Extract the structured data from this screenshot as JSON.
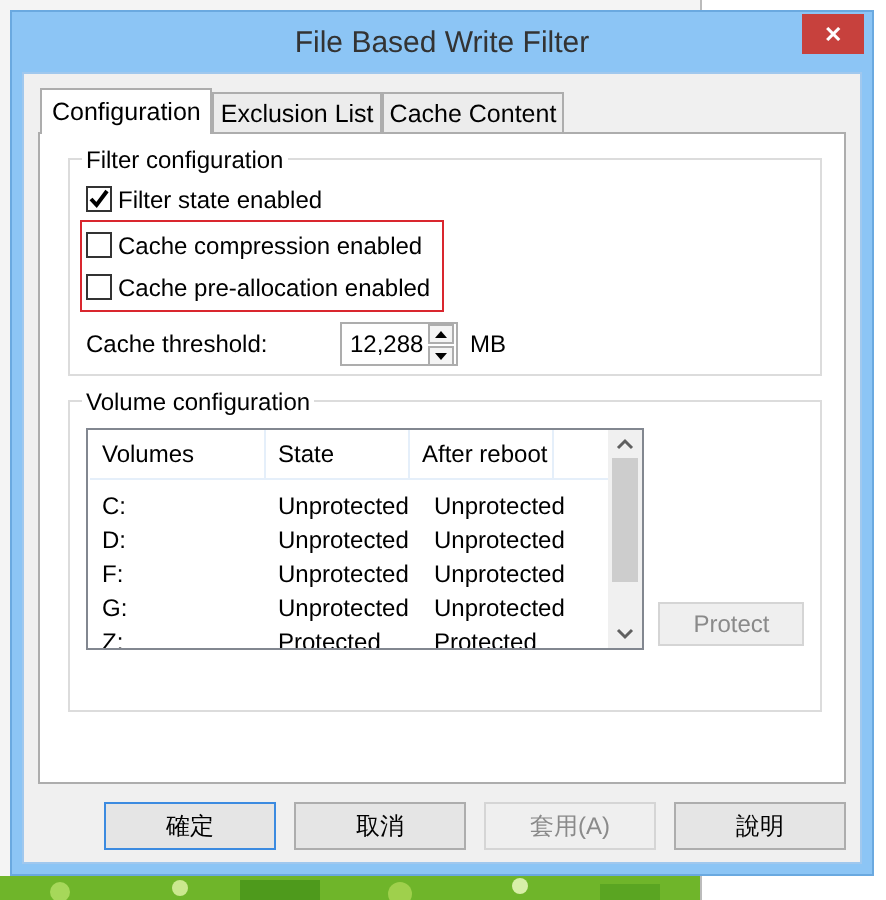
{
  "window": {
    "title": "File Based Write Filter",
    "close": "✕"
  },
  "tabs": [
    {
      "label": "Configuration",
      "selected": true
    },
    {
      "label": "Exclusion List",
      "selected": false
    },
    {
      "label": "Cache Content",
      "selected": false
    }
  ],
  "filter_configuration": {
    "title": "Filter configuration",
    "options": [
      {
        "label": "Filter state enabled",
        "checked": true,
        "highlighted": false
      },
      {
        "label": "Cache compression enabled",
        "checked": false,
        "highlighted": true
      },
      {
        "label": "Cache pre-allocation enabled",
        "checked": false,
        "highlighted": true
      }
    ],
    "threshold": {
      "label": "Cache threshold:",
      "value": "12,288",
      "unit": "MB"
    }
  },
  "volume_configuration": {
    "title": "Volume configuration",
    "columns": [
      "Volumes",
      "State",
      "After reboot"
    ],
    "rows": [
      [
        "C:",
        "Unprotected",
        "Unprotected"
      ],
      [
        "D:",
        "Unprotected",
        "Unprotected"
      ],
      [
        "F:",
        "Unprotected",
        "Unprotected"
      ],
      [
        "G:",
        "Unprotected",
        "Unprotected"
      ],
      [
        "Z:",
        "Protected",
        "Protected"
      ]
    ],
    "protect_button": {
      "label": "Protect",
      "disabled": true
    }
  },
  "buttons": [
    {
      "label": "確定",
      "default": true,
      "disabled": false
    },
    {
      "label": "取消",
      "default": false,
      "disabled": false
    },
    {
      "label": "套用(A)",
      "default": false,
      "disabled": true
    },
    {
      "label": "說明",
      "default": false,
      "disabled": false
    }
  ]
}
